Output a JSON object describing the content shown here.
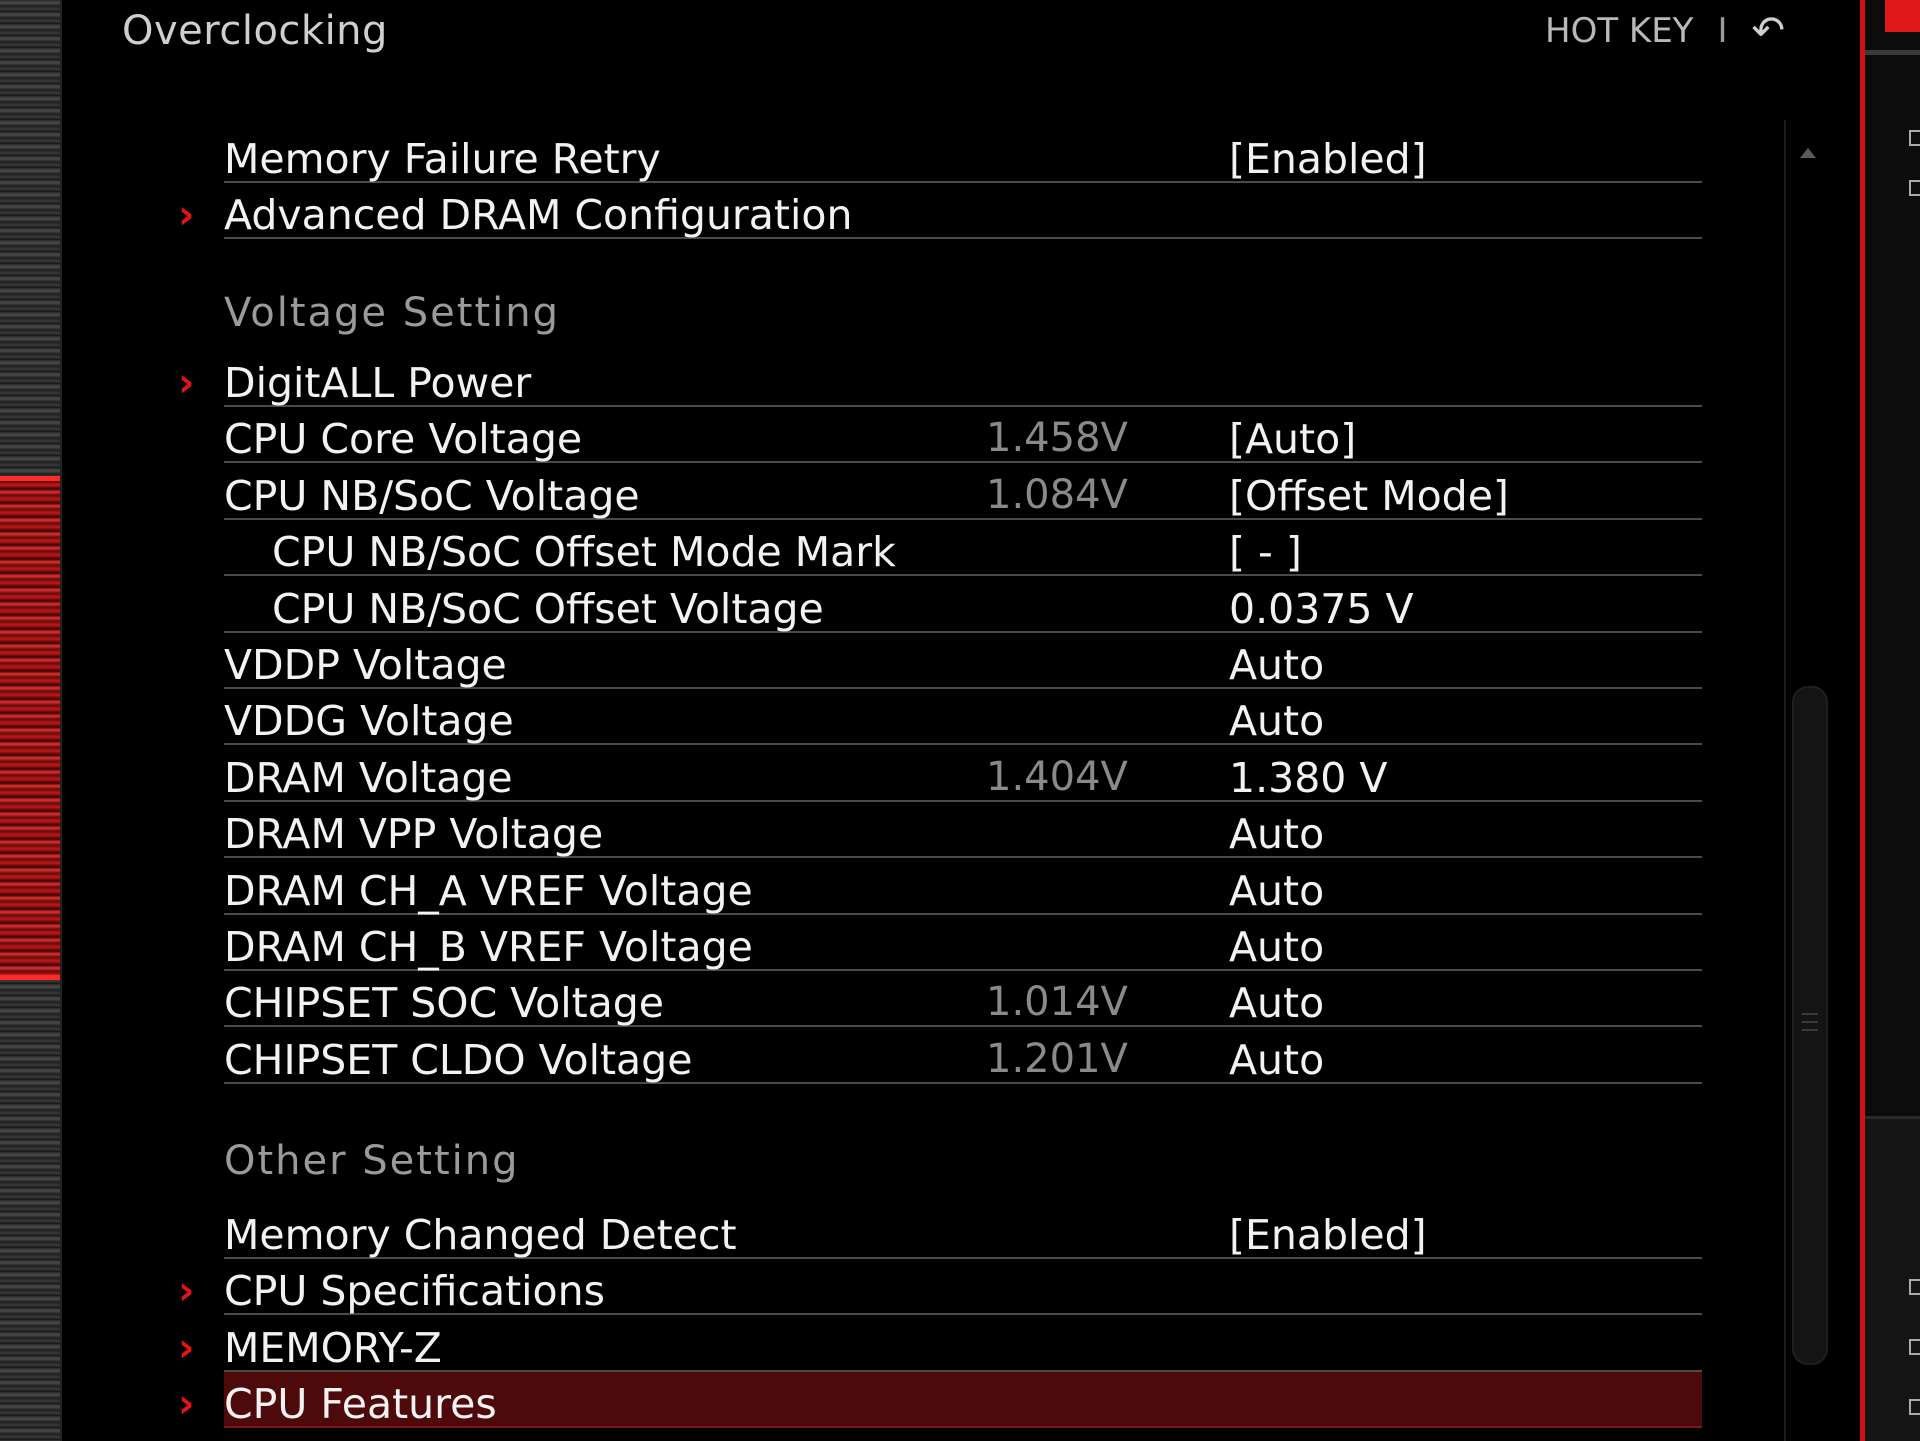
{
  "header": {
    "title": "Overclocking",
    "hotkey_label": "HOT KEY",
    "separator": "I",
    "back_glyph": "↶"
  },
  "rows_top": [
    {
      "label": "Memory Failure Retry",
      "reading": "",
      "value": "[Enabled]",
      "submenu": false
    },
    {
      "label": "Advanced DRAM Configuration",
      "reading": "",
      "value": "",
      "submenu": true
    }
  ],
  "sections": {
    "voltage": "Voltage  Setting",
    "other": "Other  Setting"
  },
  "voltage_rows": [
    {
      "label": "DigitALL Power",
      "reading": "",
      "value": "",
      "submenu": true
    },
    {
      "label": "CPU Core Voltage",
      "reading": "1.458V",
      "value": "[Auto]",
      "submenu": false
    },
    {
      "label": "CPU NB/SoC Voltage",
      "reading": "1.084V",
      "value": "[Offset Mode]",
      "submenu": false
    },
    {
      "label": "CPU NB/SoC Offset Mode Mark",
      "reading": "",
      "value": "[ - ]",
      "submenu": false,
      "indent": true
    },
    {
      "label": "CPU NB/SoC Offset Voltage",
      "reading": "",
      "value": "0.0375 V",
      "submenu": false,
      "indent": true
    },
    {
      "label": "VDDP Voltage",
      "reading": "",
      "value": "Auto",
      "submenu": false
    },
    {
      "label": "VDDG Voltage",
      "reading": "",
      "value": "Auto",
      "submenu": false
    },
    {
      "label": "DRAM Voltage",
      "reading": "1.404V",
      "value": "1.380 V",
      "submenu": false
    },
    {
      "label": "DRAM VPP Voltage",
      "reading": "",
      "value": "Auto",
      "submenu": false
    },
    {
      "label": "DRAM CH_A VREF Voltage",
      "reading": "",
      "value": "Auto",
      "submenu": false
    },
    {
      "label": "DRAM CH_B VREF Voltage",
      "reading": "",
      "value": "Auto",
      "submenu": false
    },
    {
      "label": "CHIPSET SOC Voltage",
      "reading": "1.014V",
      "value": "Auto",
      "submenu": false
    },
    {
      "label": "CHIPSET CLDO Voltage",
      "reading": "1.201V",
      "value": "Auto",
      "submenu": false
    }
  ],
  "other_rows": [
    {
      "label": "Memory Changed Detect",
      "reading": "",
      "value": "[Enabled]",
      "submenu": false
    },
    {
      "label": "CPU Specifications",
      "reading": "",
      "value": "",
      "submenu": true
    },
    {
      "label": "MEMORY-Z",
      "reading": "",
      "value": "",
      "submenu": true
    },
    {
      "label": "CPU Features",
      "reading": "",
      "value": "",
      "submenu": true,
      "selected": true
    }
  ],
  "icons": {
    "submenu": "chevron-right-icon",
    "back": "back-arrow-icon",
    "scroll_up": "scroll-up-arrow-icon"
  },
  "colors": {
    "accent": "#e01414",
    "selected_row": "#4e0a0a",
    "text": "#f2f2f2",
    "reading": "#8a8a8a",
    "section": "#9a9a9a"
  }
}
